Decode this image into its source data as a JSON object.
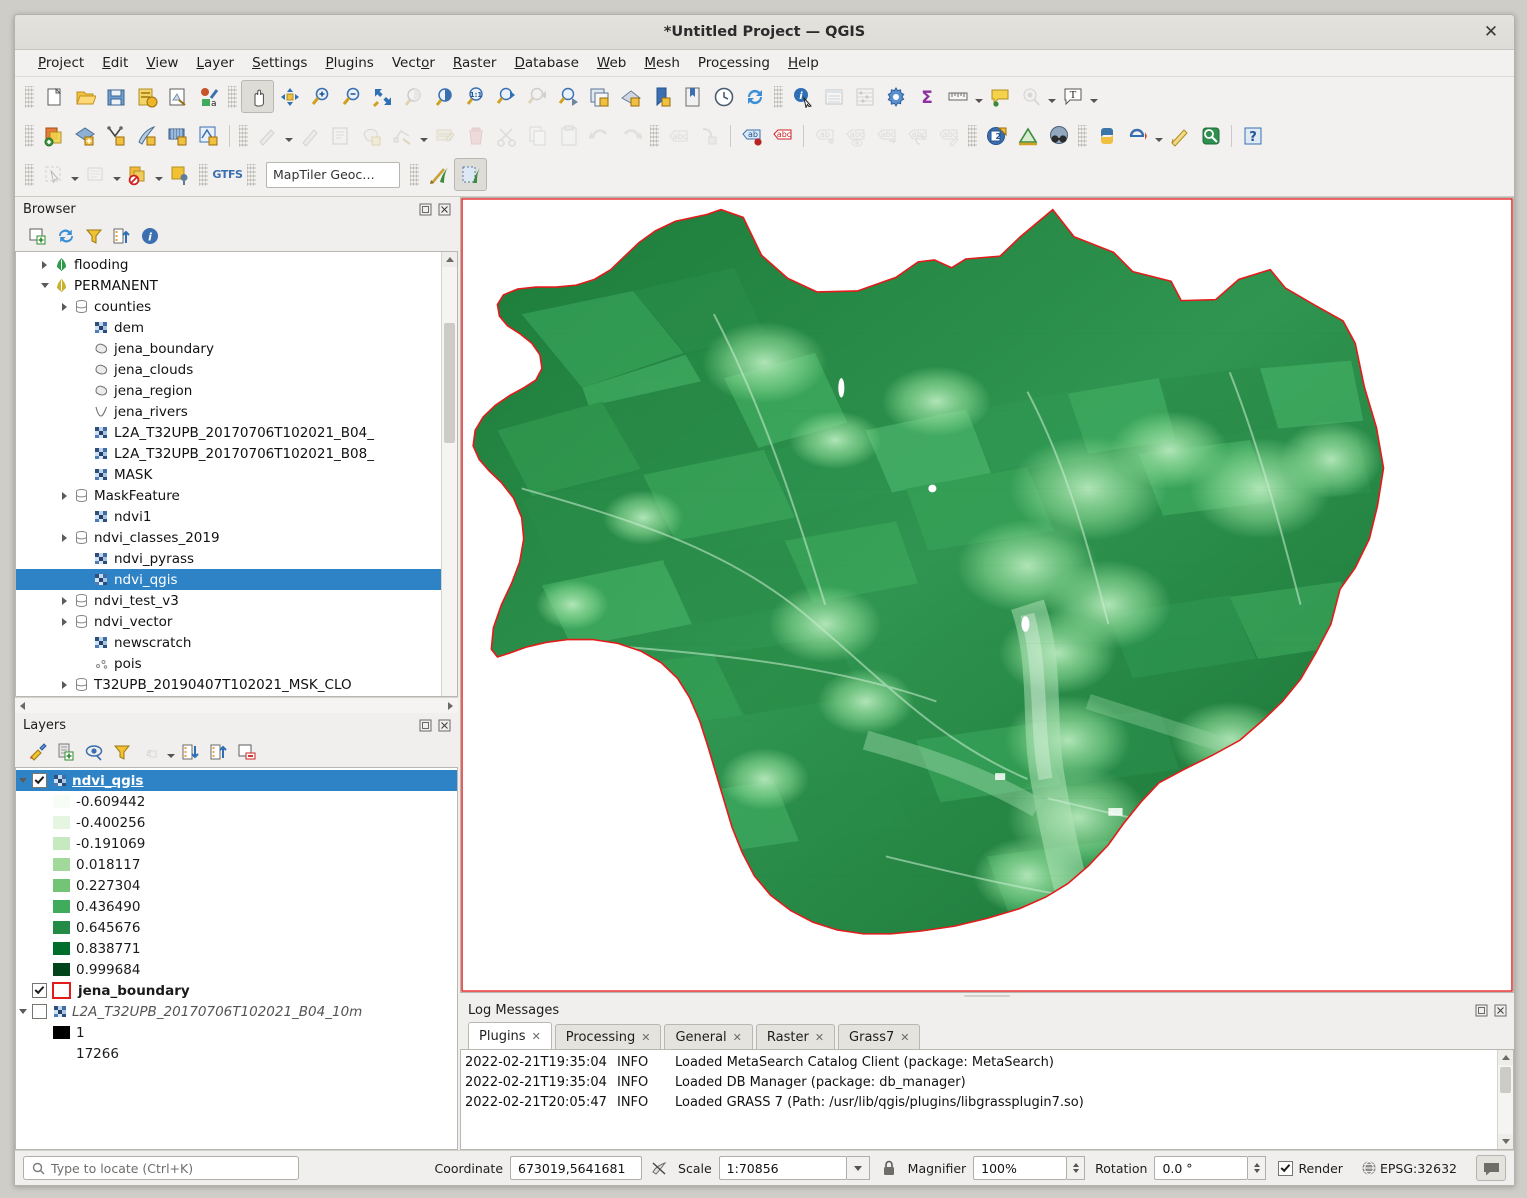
{
  "window": {
    "title": "*Untitled Project — QGIS",
    "close_label": "✕"
  },
  "menubar": {
    "items": [
      {
        "label": "Project",
        "accel": "P"
      },
      {
        "label": "Edit",
        "accel": "E"
      },
      {
        "label": "View",
        "accel": "V"
      },
      {
        "label": "Layer",
        "accel": "L"
      },
      {
        "label": "Settings",
        "accel": "S"
      },
      {
        "label": "Plugins",
        "accel": "P"
      },
      {
        "label": "Vector",
        "accel": "o"
      },
      {
        "label": "Raster",
        "accel": "R"
      },
      {
        "label": "Database",
        "accel": "D"
      },
      {
        "label": "Web",
        "accel": "W"
      },
      {
        "label": "Mesh",
        "accel": "M"
      },
      {
        "label": "Processing",
        "accel": "c"
      },
      {
        "label": "Help",
        "accel": "H"
      }
    ]
  },
  "toolbar": {
    "row1": [
      "new-project-icon",
      "open-project-icon",
      "save-project-icon",
      "save-project-as-icon",
      "new-print-layout-icon",
      "style-manager-icon",
      "pan-map-icon",
      "pan-to-selection-icon",
      "zoom-in-icon",
      "zoom-out-icon",
      "zoom-full-icon",
      "zoom-to-selection-icon",
      "zoom-to-layer-icon",
      "zoom-native-icon",
      "zoom-last-icon",
      "zoom-next-icon",
      "refresh-extent-icon",
      "new-map-view-icon",
      "new-3d-map-view-icon",
      "new-bookmark-icon",
      "show-bookmarks-icon",
      "temporal-controller-icon",
      "refresh-icon",
      "identify-features-icon",
      "open-attribute-table-icon",
      "open-field-calculator-icon",
      "options-icon",
      "statistical-summary-icon",
      "measure-line-icon",
      "map-tips-icon",
      "show-unplaced-labels-icon",
      "new-text-annotation-icon"
    ],
    "row2": [
      "add-vector-layer-icon",
      "add-raster-layer-icon",
      "add-delimited-text-icon",
      "add-wfs-layer-icon",
      "add-mesh-layer-icon",
      "add-virtual-layer-icon",
      "current-edits-icon",
      "toggle-editing-icon",
      "save-layer-edits-icon",
      "add-polygon-feature-icon",
      "vertex-tool-icon",
      "modify-attributes-icon",
      "delete-selected-icon",
      "cut-features-icon",
      "copy-features-icon",
      "paste-features-icon",
      "undo-icon",
      "redo-icon",
      "label-toolbar-icon",
      "offset-curve-icon",
      "pin-labels-icon",
      "highlight-labels-icon",
      "move-label-icon",
      "show-hide-labels-icon",
      "rotate-label-icon",
      "change-label-icon",
      "change-label-properties-icon",
      "georeferencer-icon",
      "terrain-profile-icon",
      "search-qms-icon",
      "python-console-icon",
      "plugin-manager-icon",
      "edit-script-icon",
      "metasearch-icon",
      "help-icon"
    ],
    "row3": [
      "select-features-icon",
      "deselect-features-icon",
      "select-by-expression-icon",
      "select-by-location-icon",
      "gtfs-icon",
      "geocoder-icon",
      "grass-tools-icon",
      "grass-region-icon"
    ],
    "geocoder_value": "MapTiler Geoc…",
    "gtfs_label": "GTFS"
  },
  "browser": {
    "title": "Browser",
    "tools": [
      "add-layer-icon",
      "refresh-icon",
      "filter-browser-icon",
      "collapse-all-icon",
      "properties-icon"
    ],
    "dock_buttons": [
      "undock-icon",
      "close-icon"
    ],
    "items": [
      {
        "label": "flooding",
        "indent": 3,
        "arrow": "right",
        "icon": "grass-mapset-icon"
      },
      {
        "label": "PERMANENT",
        "indent": 3,
        "arrow": "down",
        "icon": "grass-mapset-open-icon"
      },
      {
        "label": "counties",
        "indent": 4,
        "arrow": "right",
        "icon": "database-table-icon"
      },
      {
        "label": "dem",
        "indent": 5,
        "arrow": "none",
        "icon": "raster-layer-icon"
      },
      {
        "label": "jena_boundary",
        "indent": 5,
        "arrow": "none",
        "icon": "polygon-layer-icon"
      },
      {
        "label": "jena_clouds",
        "indent": 5,
        "arrow": "none",
        "icon": "polygon-layer-icon"
      },
      {
        "label": "jena_region",
        "indent": 5,
        "arrow": "none",
        "icon": "polygon-layer-icon"
      },
      {
        "label": "jena_rivers",
        "indent": 5,
        "arrow": "none",
        "icon": "line-layer-icon"
      },
      {
        "label": "L2A_T32UPB_20170706T102021_B04_",
        "indent": 5,
        "arrow": "none",
        "icon": "raster-layer-icon"
      },
      {
        "label": "L2A_T32UPB_20170706T102021_B08_",
        "indent": 5,
        "arrow": "none",
        "icon": "raster-layer-icon"
      },
      {
        "label": "MASK",
        "indent": 5,
        "arrow": "none",
        "icon": "raster-layer-icon"
      },
      {
        "label": "MaskFeature",
        "indent": 4,
        "arrow": "right",
        "icon": "database-table-icon"
      },
      {
        "label": "ndvi1",
        "indent": 5,
        "arrow": "none",
        "icon": "raster-layer-icon"
      },
      {
        "label": "ndvi_classes_2019",
        "indent": 4,
        "arrow": "right",
        "icon": "database-table-icon"
      },
      {
        "label": "ndvi_pyrass",
        "indent": 5,
        "arrow": "none",
        "icon": "raster-layer-icon"
      },
      {
        "label": "ndvi_qgis",
        "indent": 5,
        "arrow": "none",
        "icon": "raster-layer-icon",
        "selected": true
      },
      {
        "label": "ndvi_test_v3",
        "indent": 4,
        "arrow": "right",
        "icon": "database-table-icon"
      },
      {
        "label": "ndvi_vector",
        "indent": 4,
        "arrow": "right",
        "icon": "database-table-icon"
      },
      {
        "label": "newscratch",
        "indent": 5,
        "arrow": "none",
        "icon": "raster-layer-icon"
      },
      {
        "label": "pois",
        "indent": 5,
        "arrow": "none",
        "icon": "point-layer-icon"
      },
      {
        "label": "T32UPB_20190407T102021_MSK_CLO",
        "indent": 4,
        "arrow": "right",
        "icon": "database-table-icon"
      }
    ]
  },
  "layers": {
    "title": "Layers",
    "tools": [
      "open-layer-styling-icon",
      "add-group-icon",
      "manage-map-themes-icon",
      "filter-legend-icon",
      "filter-legend-expression-icon",
      "expand-all-icon",
      "collapse-all-icon",
      "remove-layer-icon"
    ],
    "dock_buttons": [
      "undock-icon",
      "close-icon"
    ],
    "ndvi_layer": {
      "name": "ndvi_qgis",
      "checked": true,
      "selected": true,
      "icon": "raster-layer-icon"
    },
    "ndvi_legend": [
      {
        "value": "-0.609442",
        "color": "#f7fcf5"
      },
      {
        "value": "-0.400256",
        "color": "#e5f5e0"
      },
      {
        "value": "-0.191069",
        "color": "#c7e9c0"
      },
      {
        "value": "0.018117",
        "color": "#a1d99b"
      },
      {
        "value": "0.227304",
        "color": "#74c476"
      },
      {
        "value": "0.436490",
        "color": "#41ab5d"
      },
      {
        "value": "0.645676",
        "color": "#238b45"
      },
      {
        "value": "0.838771",
        "color": "#006d2c"
      },
      {
        "value": "0.999684",
        "color": "#00441b"
      }
    ],
    "boundary_layer": {
      "name": "jena_boundary",
      "checked": true,
      "outline_color": "#e31b1b"
    },
    "b04_layer": {
      "name": "L2A_T32UPB_20170706T102021_B04_10m",
      "checked": false,
      "icon": "raster-layer-icon"
    },
    "b04_legend": [
      {
        "value": "1",
        "color": "#000000"
      },
      {
        "value": "17266",
        "color": null
      }
    ]
  },
  "log": {
    "title": "Log Messages",
    "tabs": [
      {
        "label": "Plugins",
        "active": true,
        "close": "✕"
      },
      {
        "label": "Processing",
        "active": false,
        "close": "✕"
      },
      {
        "label": "General",
        "active": false,
        "close": "✕"
      },
      {
        "label": "Raster",
        "active": false,
        "close": "✕"
      },
      {
        "label": "Grass7",
        "active": false,
        "close": "✕"
      }
    ],
    "dock_buttons": [
      "undock-icon",
      "close-icon"
    ],
    "entries": [
      {
        "timestamp": "2022-02-21T19:35:04",
        "level": "INFO",
        "message": "Loaded MetaSearch Catalog Client (package: MetaSearch)"
      },
      {
        "timestamp": "2022-02-21T19:35:04",
        "level": "INFO",
        "message": "Loaded DB Manager (package: db_manager)"
      },
      {
        "timestamp": "2022-02-21T20:05:47",
        "level": "INFO",
        "message": "Loaded GRASS 7 (Path: /usr/lib/qgis/plugins/libgrassplugin7.so)"
      }
    ]
  },
  "statusbar": {
    "locate_placeholder": "Type to locate (Ctrl+K)",
    "coordinate_label": "Coordinate",
    "coordinate_value": "673019,5641681",
    "scale_label": "Scale",
    "scale_value": "1:70856",
    "magnifier_label": "Magnifier",
    "magnifier_value": "100%",
    "rotation_label": "Rotation",
    "rotation_value": "0.0 °",
    "render_label": "Render",
    "render_checked": true,
    "crs_label": "EPSG:32632",
    "messages_icon": "messages-icon",
    "lock_icon": "lock-scale-icon",
    "toggle_coord_icon": "toggle-extents-icon",
    "crs_icon": "crs-globe-icon"
  },
  "map": {
    "canvas_bg": "#ffffff",
    "boundary_color": "#e31b1b",
    "raster_name": "ndvi_qgis"
  }
}
